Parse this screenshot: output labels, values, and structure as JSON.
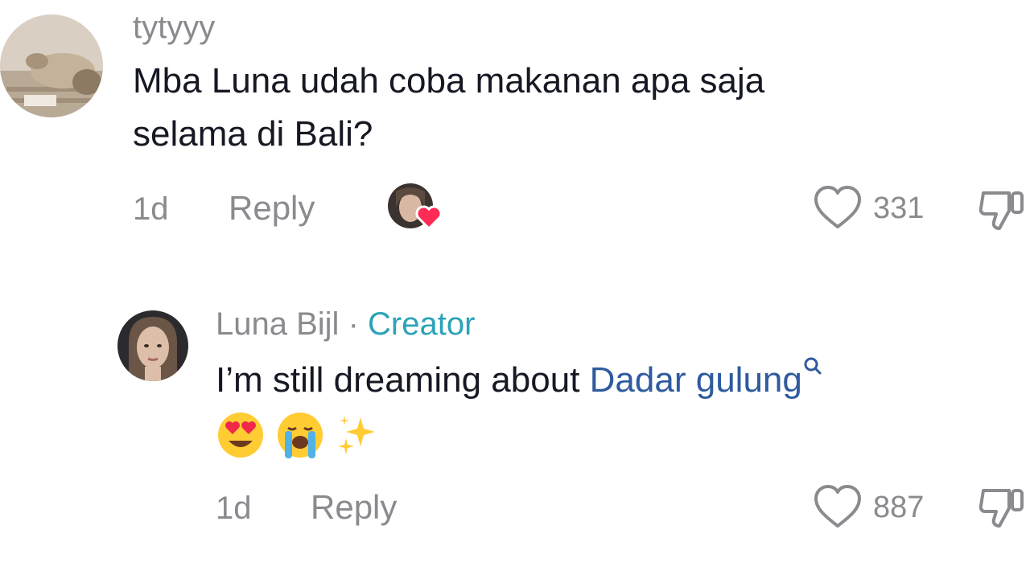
{
  "comment": {
    "username": "tytyyy",
    "text_line1": "Mba Luna udah coba makanan apa saja",
    "text_line2": "selama di Bali?",
    "time": "1d",
    "reply_label": "Reply",
    "like_count": "331"
  },
  "reply": {
    "username": "Luna Bijl",
    "separator": "·",
    "badge": "Creator",
    "text_prefix": "I’m still dreaming about",
    "link_text": "Dadar gulung",
    "emojis": [
      "heart-eyes",
      "crying",
      "sparkles"
    ],
    "time": "1d",
    "reply_label": "Reply",
    "like_count": "887"
  },
  "colors": {
    "text": "#161823",
    "secondary": "#8a8a8f",
    "creator": "#2aa3b8",
    "link": "#2f5b9e",
    "heart": "#fe2c55"
  }
}
